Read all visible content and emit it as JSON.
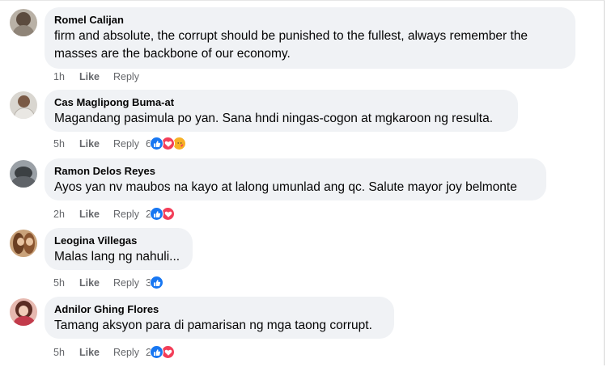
{
  "comments": [
    {
      "name": "Romel Calijan",
      "lines": [
        "firm and absolute, the corrupt should be punished to the fullest, always remember the",
        "masses are the backbone of our economy."
      ],
      "time": "1h",
      "like": "Like",
      "reply": "Reply",
      "reaction_count": "",
      "reactions": []
    },
    {
      "name": "Cas Maglipong Buma-at",
      "lines": [
        "Magandang pasimula po yan. Sana hndi ningas-cogon at mgkaroon ng resulta."
      ],
      "time": "5h",
      "like": "Like",
      "reply": "Reply",
      "reaction_count": "6",
      "reactions": [
        "like-icon",
        "heart-icon",
        "care-icon"
      ]
    },
    {
      "name": "Ramon Delos Reyes",
      "lines": [
        "Ayos yan nv maubos na kayo at lalong umunlad ang qc. Salute mayor joy belmonte"
      ],
      "time": "2h",
      "like": "Like",
      "reply": "Reply",
      "reaction_count": "2",
      "reactions": [
        "like-icon",
        "heart-icon"
      ]
    },
    {
      "name": "Leogina Villegas",
      "lines": [
        "Malas lang ng nahuli..."
      ],
      "time": "5h",
      "like": "Like",
      "reply": "Reply",
      "reaction_count": "3",
      "reactions": [
        "like-icon"
      ]
    },
    {
      "name": "Adnilor Ghing Flores",
      "lines": [
        "Tamang aksyon para di pamarisan ng mga taong corrupt."
      ],
      "time": "5h",
      "like": "Like",
      "reply": "Reply",
      "reaction_count": "2",
      "reactions": [
        "like-icon",
        "heart-icon"
      ]
    }
  ],
  "colors": {
    "bubble": "#f0f2f5",
    "meta_text": "#65676b",
    "like_blue": "#1877f2",
    "heart_red": "#f33e58",
    "care_yellow": "#f7b125"
  }
}
